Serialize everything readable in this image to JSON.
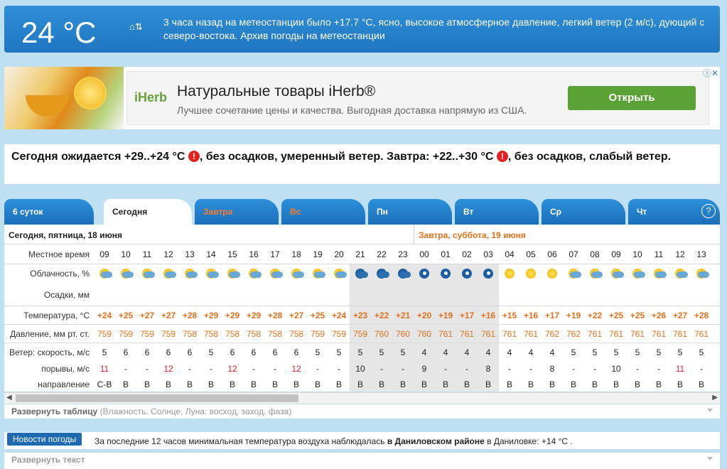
{
  "header": {
    "temperature": "24 °C",
    "station_icon": "⌂⇅",
    "message": "3 часа назад на метеостанции было +17.7 °C, ясно, высокое атмосферное давление, легкий ветер (2 м/с), дующий с северо-востока. Архив погоды на метеостанции"
  },
  "ad": {
    "brand": "iHerb",
    "title": "Натуральные товары iHerb®",
    "description": "Лучшее сочетание цены и качества. Выгодная доставка напрямую из США.",
    "button": "Открыть",
    "info_icon": "ⓘ✕"
  },
  "forecast": {
    "part1": "Сегодня ожидается +29..+24 °C",
    "part2": ", без осадков, умеренный ветер. Завтра: +22..+30 °C",
    "part3": ", без осадков, слабый ветер.",
    "warn": "!"
  },
  "tabs": [
    {
      "label": "6 суток",
      "left": 0
    },
    {
      "label": "Сегодня",
      "left": 0
    },
    {
      "label": "Завтра",
      "left": 0
    },
    {
      "label": "Вс",
      "left": 0
    },
    {
      "label": "Пн",
      "left": 0
    },
    {
      "label": "Вт",
      "left": 0
    },
    {
      "label": "Ср",
      "left": 0
    },
    {
      "label": "Чт",
      "left": 0
    }
  ],
  "help_icon": "?",
  "table": {
    "day1": "Сегодня, пятница, 18 июня",
    "day2": "Завтра, суббота, 19 июня",
    "labels": {
      "time": "Местное время",
      "clouds": "Облачность, %",
      "precip": "Осадки, мм",
      "temp": "Температура, °C",
      "pressure": "Давление, мм рт. ст.",
      "wind": "Ветер: скорость, м/с",
      "gusts": "порывы, м/с",
      "direction": "направление"
    },
    "hours": [
      "09",
      "10",
      "11",
      "12",
      "13",
      "14",
      "15",
      "16",
      "17",
      "18",
      "19",
      "20",
      "21",
      "22",
      "23",
      "00",
      "01",
      "02",
      "03",
      "04",
      "05",
      "06",
      "07",
      "08",
      "09",
      "10",
      "11",
      "12",
      "13"
    ],
    "icons": [
      "sun-cloud",
      "sun-cloud",
      "sun-cloud",
      "sun-cloud",
      "sun-cloud",
      "sun-cloud",
      "sun-cloud",
      "sun-cloud",
      "sun-cloud",
      "sun-cloud",
      "sun-cloud",
      "sun-cloud",
      "moon-cloud",
      "moon-cloud",
      "moon-cloud",
      "moon",
      "moon",
      "moon",
      "moon",
      "sun",
      "sun",
      "sun",
      "sun-cloud",
      "sun-cloud",
      "sun-cloud",
      "sun-cloud",
      "sun-cloud",
      "sun-cloud",
      "sun-cloud"
    ],
    "temps": [
      "+24",
      "+25",
      "+27",
      "+27",
      "+28",
      "+29",
      "+29",
      "+29",
      "+28",
      "+27",
      "+25",
      "+24",
      "+23",
      "+22",
      "+21",
      "+20",
      "+19",
      "+17",
      "+16",
      "+15",
      "+16",
      "+17",
      "+19",
      "+22",
      "+25",
      "+25",
      "+26",
      "+27",
      "+28"
    ],
    "pressure": [
      "759",
      "759",
      "759",
      "759",
      "758",
      "758",
      "758",
      "758",
      "758",
      "758",
      "759",
      "759",
      "759",
      "760",
      "760",
      "760",
      "761",
      "761",
      "761",
      "761",
      "761",
      "762",
      "762",
      "761",
      "761",
      "761",
      "761",
      "761",
      "761"
    ],
    "wind": [
      "5",
      "6",
      "6",
      "6",
      "6",
      "5",
      "6",
      "6",
      "6",
      "6",
      "5",
      "5",
      "5",
      "5",
      "5",
      "4",
      "4",
      "4",
      "4",
      "4",
      "4",
      "4",
      "5",
      "5",
      "5",
      "5",
      "5",
      "5",
      "5"
    ],
    "gusts": [
      "11",
      "-",
      "-",
      "12",
      "-",
      "-",
      "12",
      "-",
      "-",
      "12",
      "-",
      "-",
      "10",
      "-",
      "-",
      "9",
      "-",
      "-",
      "8",
      "-",
      "-",
      "8",
      "-",
      "-",
      "10",
      "-",
      "-",
      "11",
      "-"
    ],
    "direction": [
      "С-В",
      "В",
      "В",
      "В",
      "В",
      "В",
      "В",
      "В",
      "В",
      "В",
      "В",
      "В",
      "В",
      "В",
      "В",
      "В",
      "В",
      "В",
      "В",
      "В",
      "В",
      "В",
      "В",
      "В",
      "В",
      "В",
      "В",
      "В",
      "В"
    ],
    "gust_red": [
      true,
      false,
      false,
      true,
      false,
      false,
      true,
      false,
      false,
      true,
      false,
      false,
      false,
      false,
      false,
      false,
      false,
      false,
      false,
      false,
      false,
      false,
      false,
      false,
      false,
      false,
      false,
      true,
      false
    ]
  },
  "expand_table": {
    "bold": "Развернуть таблицу",
    "rest": " (Влажность. Солнце, Луна: восход, заход, фаза)"
  },
  "news": {
    "badge": "Новости погоды",
    "text_before": "За последние 12 часов минимальная температура воздуха наблюдалась ",
    "text_bold": "в Даниловском районе",
    "text_after": " в Даниловке: +14 °C ."
  },
  "expand_text": "Развернуть текст"
}
